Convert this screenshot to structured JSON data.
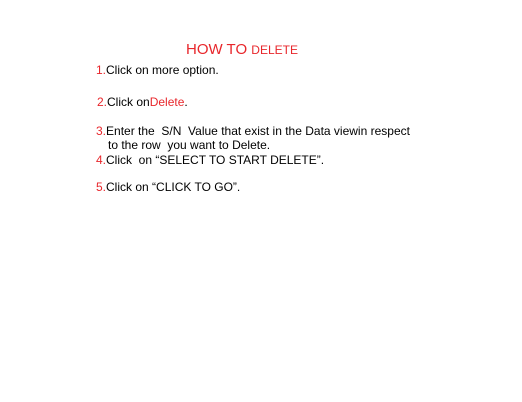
{
  "title": {
    "main": "HOW TO ",
    "small": "DELETE"
  },
  "steps": {
    "s1": {
      "num": "1.",
      "text": "Click on more option."
    },
    "s2": {
      "num": "2.",
      "text": "Click on",
      "highlight": "Delete",
      "end": "."
    },
    "s3": {
      "num": "3.",
      "text": "Enter the  S/N  Value that exist in the Data viewin respect",
      "cont": "to the row  you want to Delete."
    },
    "s4": {
      "num": "4.",
      "text": "Click  on “SELECT TO START DELETE”."
    },
    "s5": {
      "num": "5.",
      "text": "Click on “CLICK TO GO”."
    }
  },
  "colors": {
    "accent": "#e8262b",
    "text": "#000000",
    "background": "#ffffff"
  }
}
